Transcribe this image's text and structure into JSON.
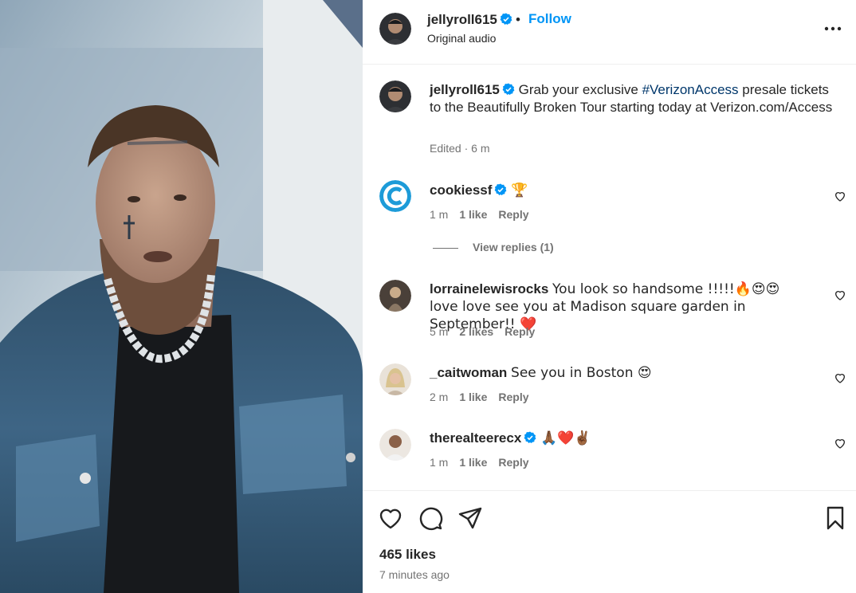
{
  "post": {
    "username": "jellyroll615",
    "follow_label": "Follow",
    "separator": "•",
    "audio_label": "Original audio"
  },
  "caption": {
    "username": "jellyroll615",
    "text_before": "Grab your exclusive ",
    "hashtag": "#VerizonAccess",
    "text_after": " presale tickets to the Beautifully Broken Tour starting today at Verizon.com/Access",
    "edited_label": "Edited · 6 m"
  },
  "comments": [
    {
      "username": "cookiessf",
      "text": "🏆",
      "time": "1 m",
      "likes": "1 like",
      "reply_label": "Reply"
    },
    {
      "username": "lorrainelewisrocks",
      "text": "You look so handsome !!!!!🔥😍😍 love love see you at Madison square garden in September!! ❤️",
      "time": "5 m",
      "likes": "2 likes",
      "reply_label": "Reply"
    },
    {
      "username": "_caitwoman",
      "text": "See you in Boston 😍",
      "time": "2 m",
      "likes": "1 like",
      "reply_label": "Reply"
    },
    {
      "username": "therealteerecx",
      "text": "🙏🏾❤️✌🏾",
      "time": "1 m",
      "likes": "1 like",
      "reply_label": "Reply"
    }
  ],
  "view_replies_label": "View replies (1)",
  "footer": {
    "likes_count": "465 likes",
    "time_ago": "7 minutes ago"
  },
  "colors": {
    "accent": "#0095f6",
    "hashtag": "#00376b",
    "verified": "#0095f6",
    "muted": "#737373"
  },
  "icons": [
    "verified-badge-icon",
    "more-options-icon",
    "heart-icon",
    "comment-icon",
    "share-icon",
    "bookmark-icon"
  ]
}
